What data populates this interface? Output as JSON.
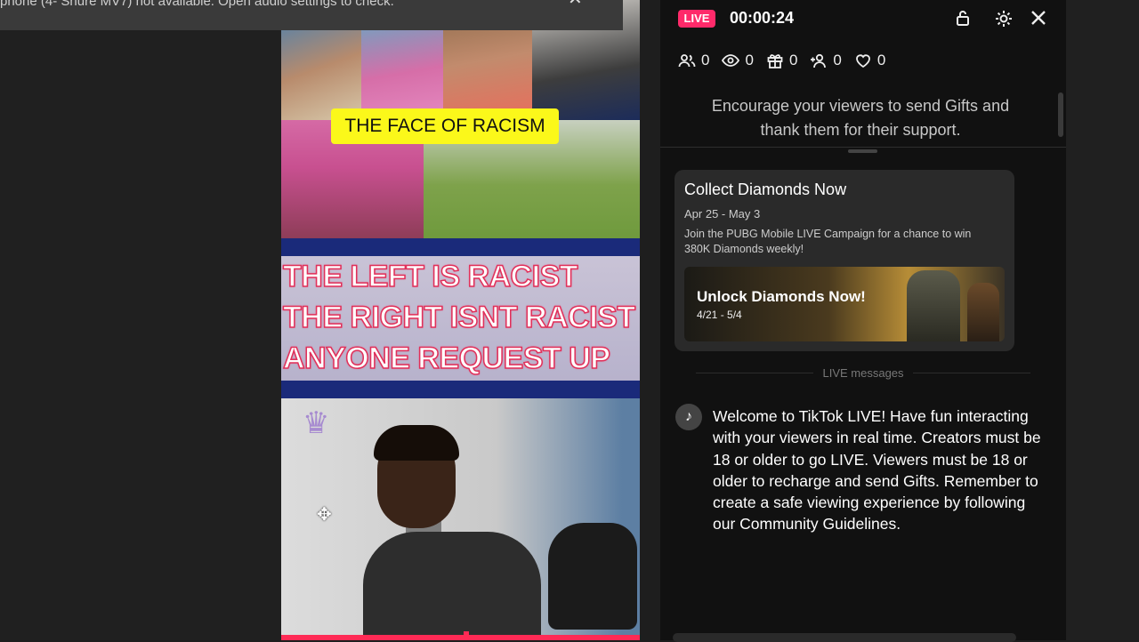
{
  "notification": {
    "text": "phone (4- Shure MV7) not available. Open audio settings to check.",
    "close_icon": "close-icon"
  },
  "video": {
    "caption_top": "THE FACE OF RACISM",
    "banner_lines": [
      "THE LEFT IS RACIST",
      "THE RIGHT ISNT RACIST",
      "ANYONE REQUEST UP"
    ]
  },
  "live_panel": {
    "badge": "LIVE",
    "timer": "00:00:24",
    "icons": [
      "lock-icon",
      "gear-icon",
      "close-icon"
    ],
    "stats": [
      {
        "icon": "viewers-icon",
        "value": "0"
      },
      {
        "icon": "eye-icon",
        "value": "0"
      },
      {
        "icon": "gift-icon",
        "value": "0"
      },
      {
        "icon": "add-user-icon",
        "value": "0"
      },
      {
        "icon": "heart-icon",
        "value": "0"
      }
    ],
    "encourage_text": "Encourage your viewers to send Gifts and thank them for their support.",
    "campaign": {
      "title": "Collect Diamonds Now",
      "date": "Apr 25 - May 3",
      "description": "Join the PUBG Mobile LIVE Campaign for a chance to win 380K Diamonds weekly!",
      "promo_title": "Unlock Diamonds Now!",
      "promo_date": "4/21 - 5/4"
    },
    "messages_label": "LIVE messages",
    "welcome_message": "Welcome to TikTok LIVE! Have fun interacting with your viewers in real time. Creators must be 18 or older to go LIVE. Viewers must be 18 or older to recharge and send Gifts. Remember to create a safe viewing experience by following our Community Guidelines."
  },
  "colors": {
    "accent": "#ff2a6a",
    "panel_bg": "#111111",
    "card_bg": "#2a2a2a"
  }
}
